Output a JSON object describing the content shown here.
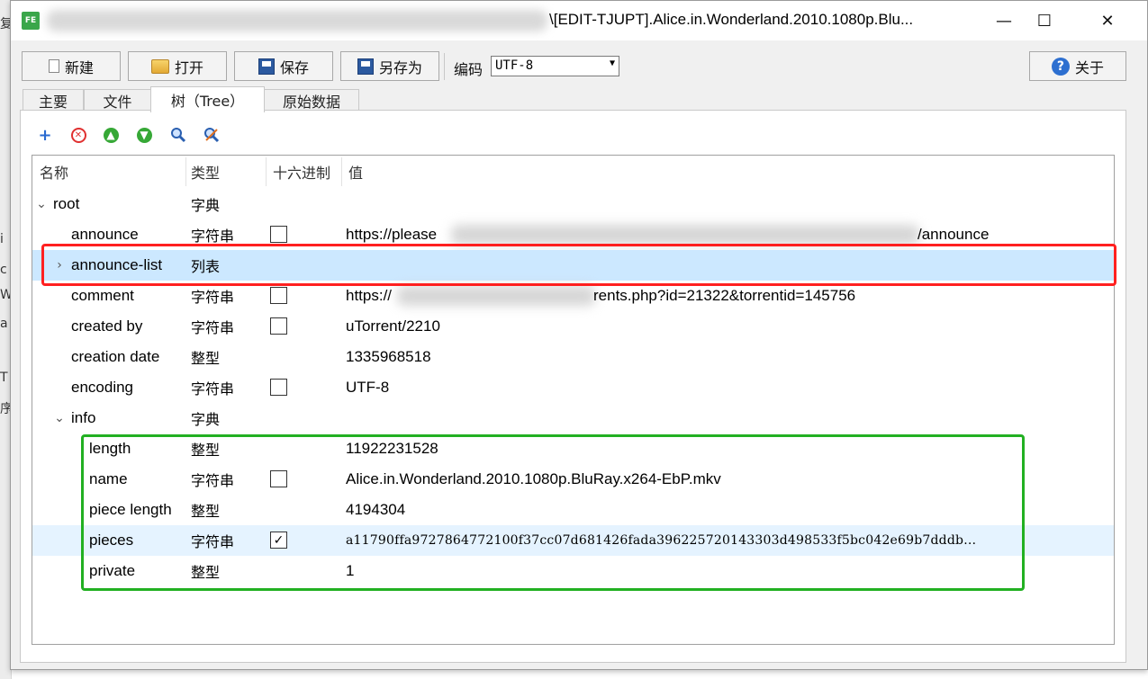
{
  "background": {
    "left_fragments": [
      "复",
      "i",
      "c",
      "W",
      "a",
      "T",
      "序"
    ]
  },
  "window": {
    "icon_text": "FE",
    "title_visible": "\\[EDIT-TJUPT].Alice.in.Wonderland.2010.1080p.Blu...",
    "controls": {
      "minimize": "—",
      "maximize": "☐",
      "close": "✕"
    }
  },
  "toolbar": {
    "new": "新建",
    "open": "打开",
    "save": "保存",
    "save_as": "另存为",
    "encoding_label": "编码",
    "encoding_value": "UTF-8",
    "about": "关于"
  },
  "tabs": [
    {
      "label": "主要",
      "active": false
    },
    {
      "label": "文件",
      "active": false
    },
    {
      "label": "树（Tree）",
      "active": true
    },
    {
      "label": "原始数据",
      "active": false
    }
  ],
  "tree_toolbar": [
    "add-icon",
    "remove-icon",
    "move-up-icon",
    "move-down-icon",
    "search-icon",
    "search-replace-icon"
  ],
  "tree": {
    "columns": {
      "name": "名称",
      "type": "类型",
      "hex": "十六进制",
      "value": "值"
    },
    "rows": [
      {
        "name": "root",
        "type": "字典",
        "level": 0,
        "expander": "expanded"
      },
      {
        "name": "announce",
        "type": "字符串",
        "level": 1,
        "checkbox": false,
        "value_start": "https://please",
        "value_end": "/announce"
      },
      {
        "name": "announce-list",
        "type": "列表",
        "level": 1,
        "expander": "collapsed",
        "selected": true
      },
      {
        "name": "comment",
        "type": "字符串",
        "level": 1,
        "checkbox": false,
        "value_start": "https://",
        "value_end": "rents.php?id=21322&torrentid=145756"
      },
      {
        "name": "created by",
        "type": "字符串",
        "level": 1,
        "checkbox": false,
        "value": "uTorrent/2210"
      },
      {
        "name": "creation date",
        "type": "整型",
        "level": 1,
        "value": "1335968518"
      },
      {
        "name": "encoding",
        "type": "字符串",
        "level": 1,
        "checkbox": false,
        "value": "UTF-8"
      },
      {
        "name": "info",
        "type": "字典",
        "level": 1,
        "expander": "expanded"
      },
      {
        "name": "length",
        "type": "整型",
        "level": 2,
        "value": "11922231528"
      },
      {
        "name": "name",
        "type": "字符串",
        "level": 2,
        "checkbox": false,
        "value": "Alice.in.Wonderland.2010.1080p.BluRay.x264-EbP.mkv"
      },
      {
        "name": "piece length",
        "type": "整型",
        "level": 2,
        "value": "4194304"
      },
      {
        "name": "pieces",
        "type": "字符串",
        "level": 2,
        "checkbox": true,
        "value": "a11790ffa9727864772100f37cc07d681426fada396225720143303d498533f5bc042e69b7dddb…",
        "hovered": true
      },
      {
        "name": "private",
        "type": "整型",
        "level": 2,
        "value": "1"
      }
    ]
  },
  "annotation_colors": {
    "red": "#ff2020",
    "green": "#22b022"
  }
}
